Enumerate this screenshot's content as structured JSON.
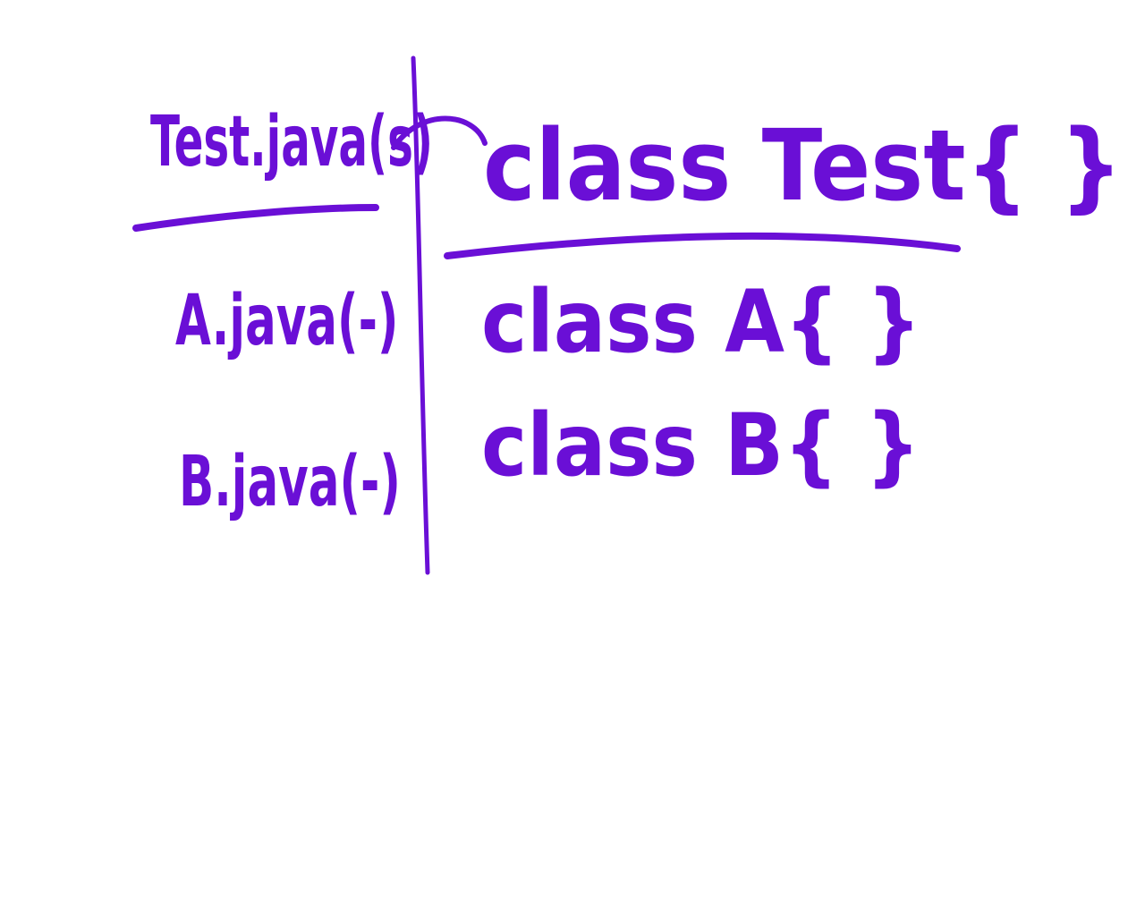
{
  "ink_color": "#6a0fd6",
  "background_color": "#ffffff",
  "left_column": {
    "test_file": "Test.java(s)",
    "a_file": "A.java(-)",
    "b_file": "B.java(-)"
  },
  "right_column": {
    "class_test": "class Test{ }",
    "class_a": "class A{ }",
    "class_b": "class B{ }"
  }
}
